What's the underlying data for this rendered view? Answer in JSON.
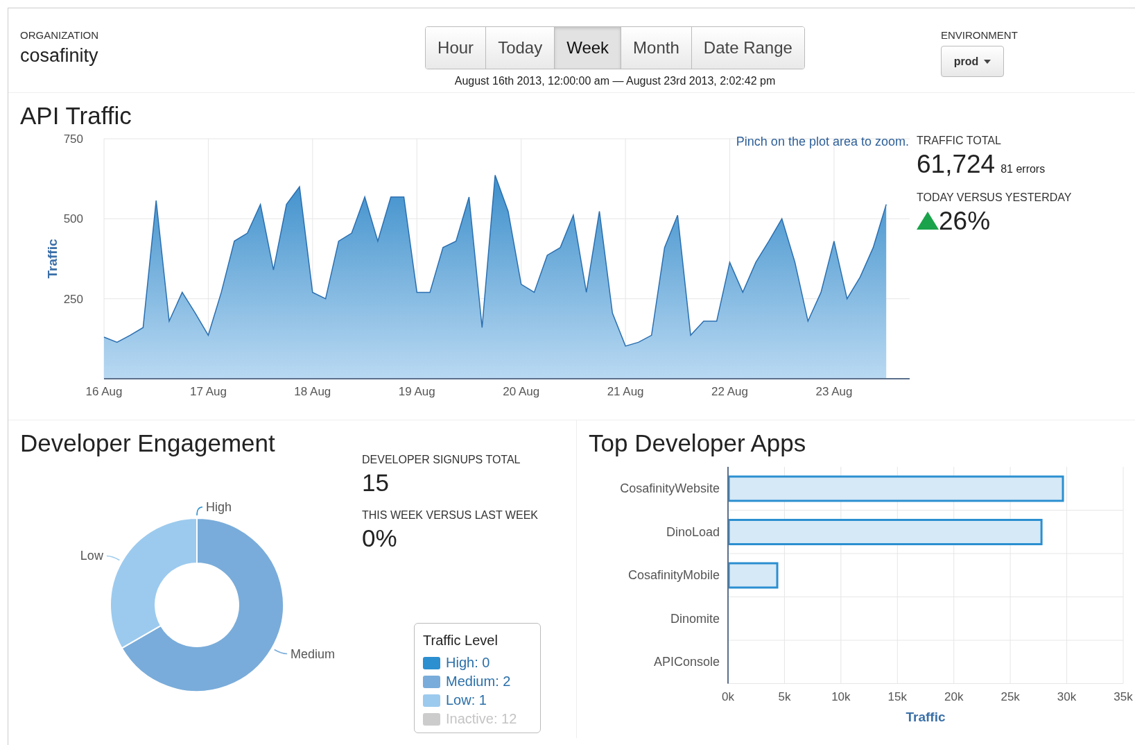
{
  "header": {
    "organization_label": "ORGANIZATION",
    "organization": "cosafinity",
    "time_tabs": [
      {
        "label": "Hour",
        "selected": false
      },
      {
        "label": "Today",
        "selected": false
      },
      {
        "label": "Week",
        "selected": true
      },
      {
        "label": "Month",
        "selected": false
      },
      {
        "label": "Date Range",
        "selected": false
      }
    ],
    "date_range": "August 16th 2013, 12:00:00 am — August 23rd 2013, 2:02:42 pm",
    "environment_label": "ENVIRONMENT",
    "environment": "prod"
  },
  "api_traffic": {
    "title": "API Traffic",
    "hint": "Pinch on the plot area to zoom.",
    "chart_data": {
      "type": "area",
      "ylabel": "Traffic",
      "categories": [
        "16 Aug",
        null,
        null,
        null,
        null,
        null,
        null,
        null,
        "17 Aug",
        null,
        null,
        null,
        null,
        null,
        null,
        null,
        "18 Aug",
        null,
        null,
        null,
        null,
        null,
        null,
        null,
        "19 Aug",
        null,
        null,
        null,
        null,
        null,
        null,
        null,
        "20 Aug",
        null,
        null,
        null,
        null,
        null,
        null,
        null,
        "21 Aug",
        null,
        null,
        null,
        null,
        null,
        null,
        null,
        "22 Aug",
        null,
        null,
        null,
        null,
        null,
        null,
        null,
        "23 Aug",
        null,
        null,
        null,
        null
      ],
      "series": [
        {
          "color": "#3d8fcb",
          "values": [
            130,
            114,
            136,
            160,
            557,
            180,
            270,
            205,
            136,
            270,
            430,
            455,
            545,
            340,
            545,
            600,
            270,
            250,
            430,
            455,
            568,
            430,
            568,
            568,
            270,
            270,
            410,
            430,
            568,
            160,
            636,
            523,
            295,
            270,
            386,
            410,
            511,
            270,
            523,
            205,
            102,
            114,
            136,
            410,
            511,
            136,
            180,
            180,
            364,
            270,
            364,
            430,
            500,
            364,
            180,
            270,
            430,
            250,
            318,
            410,
            545
          ]
        }
      ],
      "ylim": [
        0,
        750
      ],
      "grid": true,
      "yticks": [
        250,
        500,
        750
      ]
    },
    "stats": [
      {
        "label": "TRAFFIC TOTAL",
        "value": "61,724",
        "note": "81 errors",
        "kind": "total"
      },
      {
        "label": "TODAY VERSUS YESTERDAY",
        "value": "26%",
        "kind": "change"
      }
    ]
  },
  "developer_engagement": {
    "title": "Developer Engagement",
    "chart_data": {
      "type": "donut",
      "categories": [
        "High",
        "Medium",
        "Low"
      ],
      "values": [
        0,
        66.67,
        33.33
      ],
      "colors": [
        "#2b8fd0",
        "#79acda",
        "#9ccaee"
      ]
    },
    "stats": [
      {
        "label": "DEVELOPER SIGNUPS TOTAL",
        "value": "15"
      },
      {
        "label": "THIS WEEK VERSUS LAST WEEK",
        "value": "0%"
      }
    ],
    "legend": {
      "title": "Traffic Level",
      "items": [
        {
          "label": "High: 0",
          "color": "#2b8fd0",
          "dimmed": false
        },
        {
          "label": "Medium: 2",
          "color": "#79acda",
          "dimmed": false
        },
        {
          "label": "Low: 1",
          "color": "#9ccaee",
          "dimmed": false
        },
        {
          "label": "Inactive: 12",
          "color": "#cccccc",
          "dimmed": true
        }
      ]
    }
  },
  "top_developer_apps": {
    "title": "Top Developer Apps",
    "chart_data": {
      "type": "bar",
      "orientation": "horizontal",
      "xlabel": "Traffic",
      "categories": [
        "CosafinityWebsite",
        "DinoLoad",
        "CosafinityMobile",
        "Dinomite",
        "APIConsole"
      ],
      "series": [
        {
          "color": "#2b8fd0",
          "values": [
            29600,
            27700,
            4300,
            0,
            0
          ]
        }
      ],
      "xlim": [
        0,
        35000
      ],
      "grid": true,
      "xticks": [
        {
          "value": 0,
          "label": "0k"
        },
        {
          "value": 5000,
          "label": "5k"
        },
        {
          "value": 10000,
          "label": "10k"
        },
        {
          "value": 15000,
          "label": "15k"
        },
        {
          "value": 20000,
          "label": "20k"
        },
        {
          "value": 25000,
          "label": "25k"
        },
        {
          "value": 30000,
          "label": "30k"
        },
        {
          "value": 35000,
          "label": "35k"
        }
      ]
    }
  }
}
